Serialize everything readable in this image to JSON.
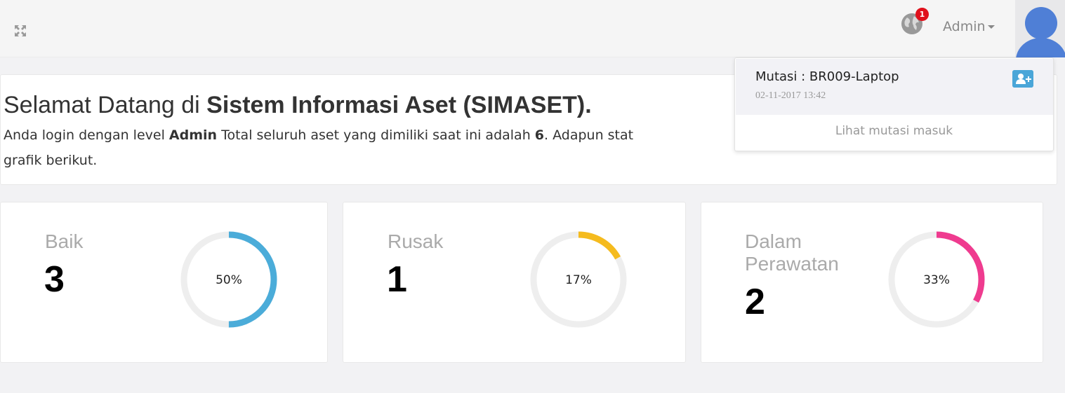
{
  "header": {
    "notification_count": "1",
    "user_label": "Admin"
  },
  "welcome": {
    "title_prefix": "Selamat Datang di ",
    "title_bold": "Sistem Informasi Aset (SIMASET).",
    "line_part1": "Anda login dengan level ",
    "level": "Admin",
    "line_part2": " Total seluruh aset yang dimiliki saat ini adalah ",
    "total": "6",
    "line_part3": ". Adapun stat",
    "line_part4": "grafik berikut."
  },
  "cards": [
    {
      "label": "Baik",
      "count": "3",
      "percent_label": "50%",
      "percent": 50,
      "color": "#4bacd9"
    },
    {
      "label": "Rusak",
      "count": "1",
      "percent_label": "17%",
      "percent": 17,
      "color": "#f5bb1e"
    },
    {
      "label_line1": "Dalam",
      "label_line2": "Perawatan",
      "count": "2",
      "percent_label": "33%",
      "percent": 33,
      "color": "#ef3b8f"
    }
  ],
  "notifications": {
    "item_title": "Mutasi : BR009-Laptop",
    "item_time": "02-11-2017 13:42",
    "footer_link": "Lihat mutasi masuk"
  },
  "chart_data": [
    {
      "type": "pie",
      "categories": [
        "Baik"
      ],
      "values": [
        50
      ]
    },
    {
      "type": "pie",
      "categories": [
        "Rusak"
      ],
      "values": [
        17
      ]
    },
    {
      "type": "pie",
      "categories": [
        "Dalam Perawatan"
      ],
      "values": [
        33
      ]
    }
  ]
}
